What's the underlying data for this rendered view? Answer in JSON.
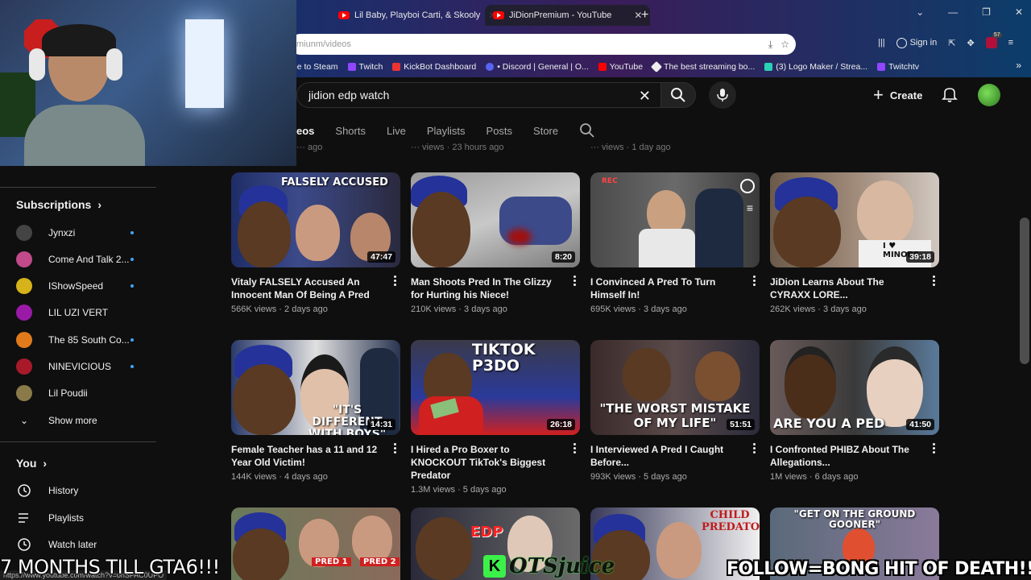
{
  "browser": {
    "tabs": [
      {
        "label": "Lil Baby, Playboi Carti, & Skooly"
      },
      {
        "label": "JiDionPremium - YouTube"
      }
    ],
    "new_tab": "+",
    "url": "miunm/videos",
    "signin_label": "Sign in",
    "bookmarks": [
      "me to Steam",
      "Twitch",
      "KickBot Dashboard",
      "• Discord | General | O...",
      "YouTube",
      "The best streaming bo...",
      "(3) Logo Maker / Strea...",
      "Twitchtv"
    ],
    "extension_badge": "57"
  },
  "header": {
    "search_value": "jidion edp watch",
    "create_label": "Create"
  },
  "channel_tabs": [
    "eos",
    "Shorts",
    "Live",
    "Playlists",
    "Posts",
    "Store"
  ],
  "prev_row_meta": [
    "··· ago",
    "··· views · 23 hours ago",
    "··· views · 1 day ago"
  ],
  "sidebar": {
    "subscriptions_title": "Subscriptions",
    "subscriptions": [
      {
        "name": "Jynxzi",
        "color": "#444444"
      },
      {
        "name": "Come And Talk 2...",
        "color": "#c04a8a"
      },
      {
        "name": "IShowSpeed",
        "color": "#d6b31a"
      },
      {
        "name": "LIL UZI VERT",
        "color": "#9a1aa8"
      },
      {
        "name": "The 85 South Co...",
        "color": "#e07a1a"
      },
      {
        "name": "NINEVICIOUS",
        "color": "#a81a2a"
      },
      {
        "name": "Lil Poudii",
        "color": "#8a7a4a"
      }
    ],
    "show_more": "Show more",
    "you_title": "You",
    "you_items": [
      "History",
      "Playlists",
      "Watch later"
    ]
  },
  "videos": [
    {
      "title": "Vitaly FALSELY Accused An Innocent Man Of Being A Pred",
      "meta": "566K views · 2 days ago",
      "duration": "47:47",
      "thumb_text": "FALSELY ACCUSED"
    },
    {
      "title": "Man Shoots Pred In The Glizzy for Hurting his Niece!",
      "meta": "210K views · 3 days ago",
      "duration": "8:20",
      "thumb_text": ""
    },
    {
      "title": "I Convinced A Pred To Turn Himself In!",
      "meta": "695K views · 3 days ago",
      "duration": "",
      "thumb_text": "REC"
    },
    {
      "title": "JiDion Learns About The CYRAXX LORE...",
      "meta": "262K views · 3 days ago",
      "duration": "39:18",
      "thumb_text": "I ♥ MINORS"
    },
    {
      "title": "Female Teacher has a 11 and 12 Year Old Victim!",
      "meta": "144K views · 4 days ago",
      "duration": "14:31",
      "thumb_text": "\"IT'S DIFFERENT WITH BOYS\""
    },
    {
      "title": "I Hired a Pro Boxer to KNOCKOUT TikTok's Biggest Predator",
      "meta": "1.3M views · 5 days ago",
      "duration": "26:18",
      "thumb_text": "TIKTOK P3DO"
    },
    {
      "title": "I Interviewed A Pred I Caught Before...",
      "meta": "993K views · 5 days ago",
      "duration": "51:51",
      "thumb_text": "\"THE WORST MISTAKE OF MY LIFE\""
    },
    {
      "title": "I Confronted PHIBZ About The Allegations...",
      "meta": "1M views · 6 days ago",
      "duration": "41:50",
      "thumb_text": "ARE YOU A PED"
    }
  ],
  "row3_texts": [
    "PRED 1",
    "PRED 2",
    "EDP",
    "CHILD PREDATOR",
    "\"GET ON THE GROUND GOONER\""
  ],
  "overlays": {
    "left": "7 MONTHS TILL GTA6!!!",
    "mid_k": "K",
    "mid_text": "OTSjuice",
    "right": "FOLLOW=BONG HIT OF DEATH!!!",
    "status_url": "https://www.youtube.com/watch?v=onSPAC0UPO"
  }
}
